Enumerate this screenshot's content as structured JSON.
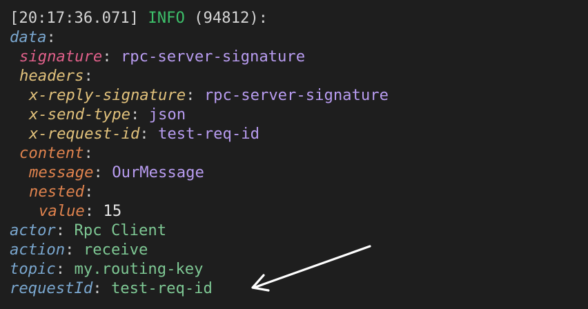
{
  "colors": {
    "background": "#1e1e1e",
    "info": "#3dbf6a",
    "key_blue": "#7aa7cf",
    "key_pink": "#e0608a",
    "key_gold": "#e2c27c",
    "key_orange": "#e0834e",
    "value_purple": "#b89cf0",
    "value_green": "#7ec894",
    "arrow": "#ffffff"
  },
  "log": {
    "timestamp": "[20:17:36.071]",
    "level": "INFO",
    "pid": "(94812):",
    "data_key": "data",
    "signature_key": "signature",
    "signature_value": "rpc-server-signature",
    "headers_key": "headers",
    "x_reply_signature_key": "x-reply-signature",
    "x_reply_signature_value": "rpc-server-signature",
    "x_send_type_key": "x-send-type",
    "x_send_type_value": "json",
    "x_request_id_key": "x-request-id",
    "x_request_id_value": "test-req-id",
    "content_key": "content",
    "message_key": "message",
    "message_value": "OurMessage",
    "nested_key": "nested",
    "value_key": "value",
    "value_value": "15",
    "actor_key": "actor",
    "actor_value": "Rpc Client",
    "action_key": "action",
    "action_value": "receive",
    "topic_key": "topic",
    "topic_value": "my.routing-key",
    "request_id_key": "requestId",
    "request_id_value": "test-req-id"
  },
  "colon": ":",
  "annotation": {
    "arrow_icon": "arrow-pointing-left-icon"
  }
}
